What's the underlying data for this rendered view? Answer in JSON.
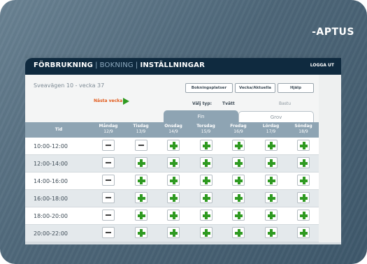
{
  "brand": {
    "logo_text": "-APTUS"
  },
  "nav": {
    "items": [
      {
        "label": "FÖRBRUKNING",
        "active": true
      },
      {
        "label": "BOKNING",
        "active": false
      },
      {
        "label": "INSTÄLLNINGAR",
        "active": true
      }
    ],
    "separator": "|",
    "logout_label": "LOGGA UT"
  },
  "panel": {
    "address": "Sveavägen 10 - vecka 37",
    "buttons": {
      "booking_rules": "Bokningsplatser",
      "week_view": "Vecka/Aktuella",
      "help": "Hjälp"
    },
    "next_week_label": "Nästa vecka",
    "choose_type_label": "Välj typ:",
    "types": {
      "laundry": "Tvätt",
      "sauna": "Bastu"
    },
    "tabs": [
      {
        "label": "Fin",
        "active": true
      },
      {
        "label": "Grov",
        "active": false
      }
    ]
  },
  "table": {
    "time_header": "Tid",
    "days": [
      {
        "day": "Måndag",
        "date": "12/9"
      },
      {
        "day": "Tisdag",
        "date": "13/9"
      },
      {
        "day": "Onsdag",
        "date": "14/9"
      },
      {
        "day": "Torsdag",
        "date": "15/9"
      },
      {
        "day": "Fredag",
        "date": "16/9"
      },
      {
        "day": "Lördag",
        "date": "17/9"
      },
      {
        "day": "Söndag",
        "date": "18/9"
      }
    ],
    "rows": [
      {
        "time": "10:00-12:00",
        "slots": [
          "busy",
          "busy",
          "free",
          "free",
          "free",
          "free",
          "free"
        ]
      },
      {
        "time": "12:00-14:00",
        "slots": [
          "busy",
          "free",
          "free",
          "free",
          "free",
          "free",
          "free"
        ]
      },
      {
        "time": "14:00-16:00",
        "slots": [
          "busy",
          "free",
          "free",
          "free",
          "free",
          "free",
          "free"
        ]
      },
      {
        "time": "16:00-18:00",
        "slots": [
          "busy",
          "free",
          "free",
          "free",
          "free",
          "free",
          "free"
        ]
      },
      {
        "time": "18:00-20:00",
        "slots": [
          "busy",
          "free",
          "free",
          "free",
          "free",
          "free",
          "free"
        ]
      },
      {
        "time": "20:00-22:00",
        "slots": [
          "busy",
          "free",
          "free",
          "free",
          "free",
          "free",
          "free"
        ]
      }
    ]
  },
  "colors": {
    "navbar": "#0f2a3f",
    "header_blue": "#8ea4b3",
    "plus_green": "#2f9a21",
    "accent_orange": "#e25b1c"
  }
}
